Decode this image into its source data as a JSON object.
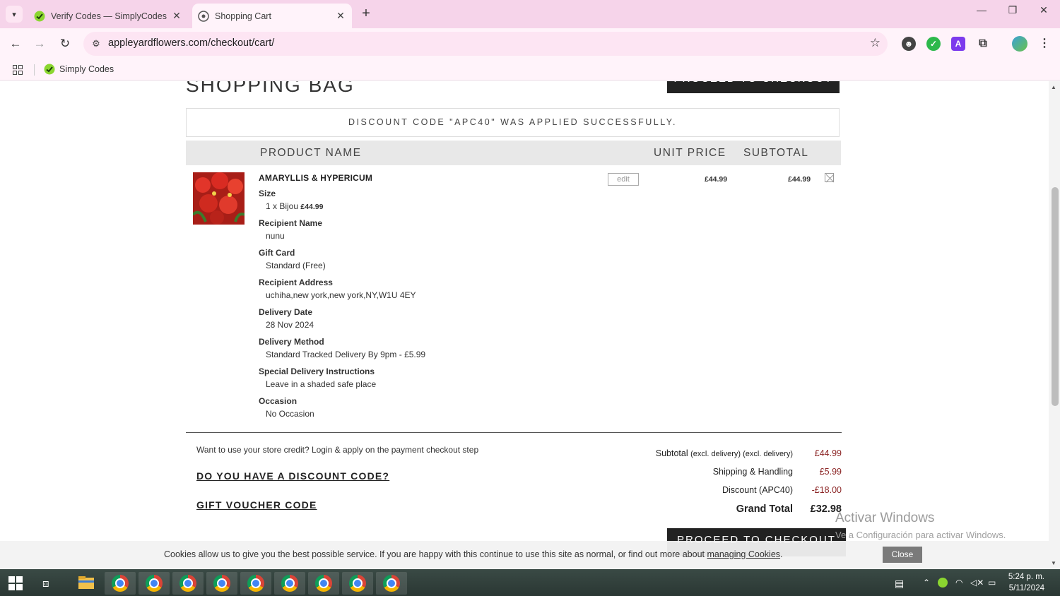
{
  "browser": {
    "tabs": [
      {
        "title": "Verify Codes — SimplyCodes",
        "active": false
      },
      {
        "title": "Shopping Cart",
        "active": true
      }
    ],
    "url": "appleyardflowers.com/checkout/cart/",
    "bookmark": "Simply Codes"
  },
  "page": {
    "title": "SHOPPING BAG",
    "checkout_top_label": "PROCEED TO CHECKOUT",
    "discount_message": "DISCOUNT CODE \"APC40\" WAS APPLIED SUCCESSFULLY.",
    "columns": {
      "product": "PRODUCT NAME",
      "unit_price": "UNIT PRICE",
      "subtotal": "SUBTOTAL"
    },
    "item": {
      "name": "AMARYLLIS & HYPERICUM",
      "edit_label": "edit",
      "unit_price": "£44.99",
      "subtotal": "£44.99",
      "size_value": "1 x Bijou",
      "size_price": "£44.99",
      "options": [
        {
          "label": "Size",
          "value": ""
        },
        {
          "label": "Recipient Name",
          "value": "nunu"
        },
        {
          "label": "Gift Card",
          "value": "Standard (Free)"
        },
        {
          "label": "Recipient Address",
          "value": "uchiha,new york,new york,NY,W1U 4EY"
        },
        {
          "label": "Delivery Date",
          "value": "28 Nov 2024"
        },
        {
          "label": "Delivery Method",
          "value": "Standard Tracked Delivery By 9pm - £5.99"
        },
        {
          "label": "Special Delivery Instructions",
          "value": "Leave in a shaded safe place"
        },
        {
          "label": "Occasion",
          "value": "No Occasion"
        }
      ]
    },
    "store_credit_note": "Want to use your store credit? Login & apply on the payment checkout step",
    "discount_link": "DO YOU HAVE A DISCOUNT CODE?",
    "voucher_link": "GIFT VOUCHER CODE",
    "totals": {
      "subtotal_label": "Subtotal",
      "subtotal_note": "(excl. delivery) (excl. delivery)",
      "subtotal": "£44.99",
      "shipping_label": "Shipping & Handling",
      "shipping": "£5.99",
      "discount_label": "Discount (APC40)",
      "discount": "-£18.00",
      "grand_label": "Grand Total",
      "grand": "£32.98"
    },
    "checkout_bottom_label": "PROCEED TO CHECKOUT"
  },
  "cookie": {
    "text": "Cookies allow us to give you the best possible service. If you are happy with this continue to use this site as normal, or find out more about",
    "link": "managing Cookies",
    "close": "Close"
  },
  "watermark": {
    "title": "Activar Windows",
    "subtitle": "Ve a Configuración para activar Windows."
  },
  "taskbar": {
    "time": "5:24 p. m.",
    "date": "5/11/2024"
  }
}
